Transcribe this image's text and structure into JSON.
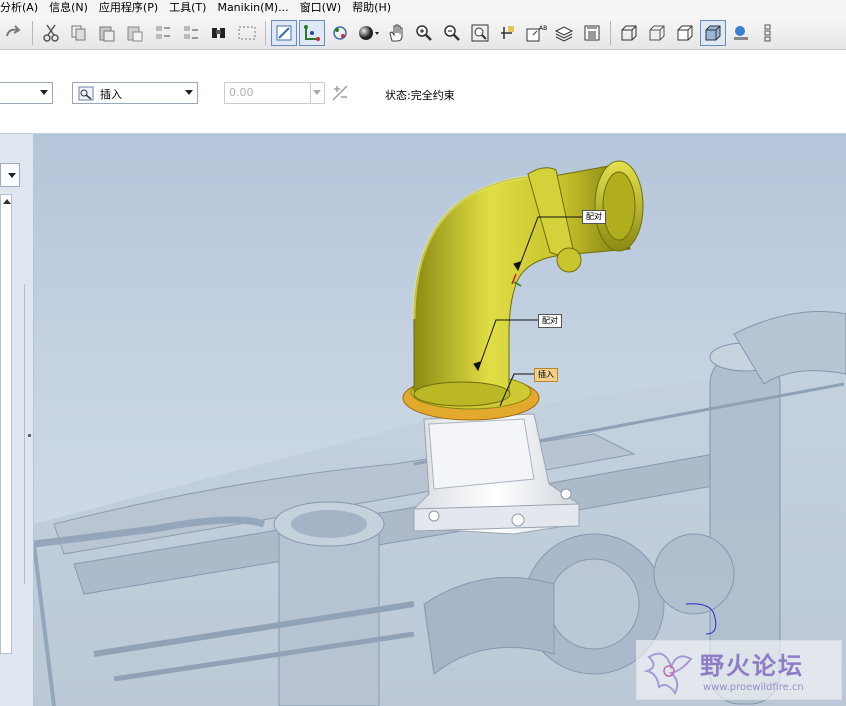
{
  "menu": {
    "items": [
      "分析(A)",
      "信息(N)",
      "应用程序(P)",
      "工具(T)",
      "Manikin(M)...",
      "窗口(W)",
      "帮助(H)"
    ]
  },
  "toolbar": {
    "icons": [
      "redo-icon",
      "cut-icon",
      "copy-icon",
      "paste-icon",
      "paste-special-icon",
      "regenerate-icon",
      "regenerate-manager-icon",
      "find-icon",
      "select-box-icon",
      "repaint-icon",
      "spin-center-icon",
      "orient-mode-icon",
      "shading-icon",
      "pan-icon",
      "zoom-in-icon",
      "zoom-out-icon",
      "refit-icon",
      "datum-display-icon",
      "axis-display-icon",
      "layers-icon",
      "shading-style-icon",
      "wireframe-icon",
      "hidden-line-icon",
      "no-hidden-icon",
      "shaded-icon",
      "enhanced-realism-icon",
      "model-tree-icon"
    ]
  },
  "dashboard": {
    "constraint_type": "插入",
    "offset_value": "0.00",
    "status": "状态:完全约束"
  },
  "viewport": {
    "annotations": [
      "配对",
      "配对",
      "插入"
    ]
  },
  "watermark": {
    "title": "野火论坛",
    "url": "www.proewildfire.cn"
  },
  "colors": {
    "part_yellow": "#c7c42a",
    "viewport_top": "#b5c6da",
    "active_tool": "#dfe8f5"
  }
}
